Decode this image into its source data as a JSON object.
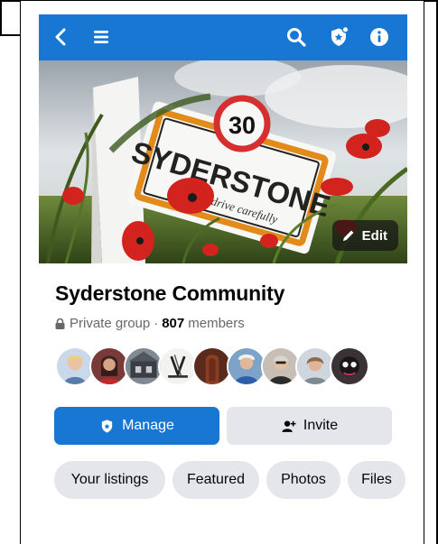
{
  "topbar": {
    "back_icon": "back-chevron-icon",
    "menu_icon": "hamburger-menu-icon",
    "search_icon": "search-icon",
    "shield_icon": "admin-shield-icon",
    "info_icon": "info-icon",
    "bar_color": "#1877d2"
  },
  "cover": {
    "sign_number": "30",
    "sign_name": "SYDERSTONE",
    "sign_subtext": "Please drive carefully",
    "edit_label": "Edit"
  },
  "group": {
    "name": "Syderstone Community",
    "privacy": "Private group",
    "separator": "·",
    "member_count": "807",
    "members_label": "members"
  },
  "actions": {
    "manage_label": "Manage",
    "invite_label": "Invite",
    "accent_color": "#1877d2"
  },
  "chips": [
    {
      "label": "Your listings"
    },
    {
      "label": "Featured"
    },
    {
      "label": "Photos"
    },
    {
      "label": "Files"
    }
  ]
}
